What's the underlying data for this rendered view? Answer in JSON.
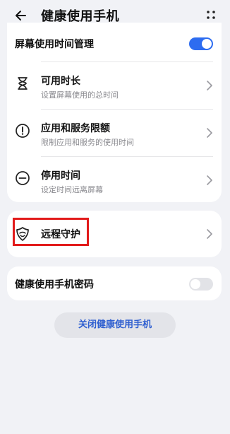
{
  "header": {
    "title": "健康使用手机",
    "back_icon": "arrow-left-icon",
    "more_icon": "more-dots-icon"
  },
  "screen_time": {
    "label": "屏幕使用时间管理",
    "toggle_on": true,
    "accent": "#2d6cf0"
  },
  "items": [
    {
      "title": "可用时长",
      "subtitle": "设置屏幕使用的总时间",
      "icon": "hourglass-icon"
    },
    {
      "title": "应用和服务限额",
      "subtitle": "限制应用和服务的使用时间",
      "icon": "exclamation-circle-icon"
    },
    {
      "title": "停用时间",
      "subtitle": "设定时间远离屏幕",
      "icon": "minus-circle-icon"
    }
  ],
  "remote": {
    "title": "远程守护",
    "icon": "shield-icon"
  },
  "password": {
    "label": "健康使用手机密码",
    "toggle_on": false
  },
  "close_button": {
    "label": "关闭健康使用手机"
  },
  "colors": {
    "background": "#f1f2f6",
    "card": "#ffffff",
    "highlight": "#e21b1b",
    "link": "#2f5fd0"
  }
}
